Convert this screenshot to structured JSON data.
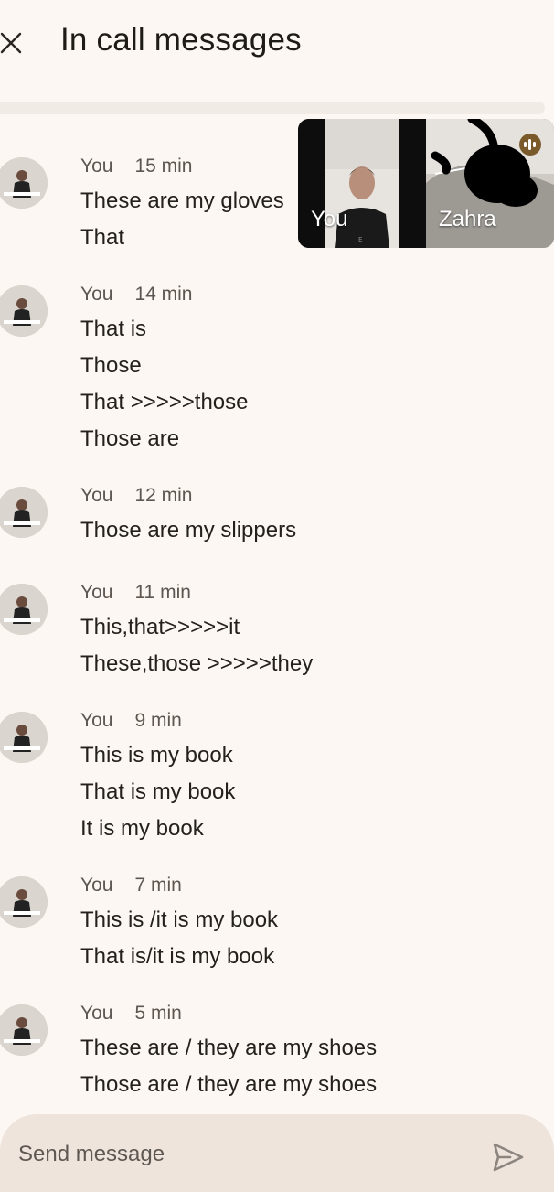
{
  "header": {
    "title": "In call messages",
    "close_icon": "close-icon"
  },
  "video": {
    "you_label": "You",
    "other_label": "Zahra"
  },
  "messages": [
    {
      "sender": "You",
      "time": "15 min",
      "lines": [
        "These are my gloves",
        "That"
      ]
    },
    {
      "sender": "You",
      "time": "14 min",
      "lines": [
        "That is",
        "Those",
        "That >>>>>those",
        "Those are"
      ]
    },
    {
      "sender": "You",
      "time": "12 min",
      "lines": [
        "Those are my slippers"
      ]
    },
    {
      "sender": "You",
      "time": "11 min",
      "lines": [
        "This,that>>>>>it",
        "These,those >>>>>they"
      ]
    },
    {
      "sender": "You",
      "time": "9 min",
      "lines": [
        "This is my book",
        "That is my book",
        "It is my book"
      ]
    },
    {
      "sender": "You",
      "time": "7 min",
      "lines": [
        "This is /it is my book",
        "That is/it is my book"
      ]
    },
    {
      "sender": "You",
      "time": "5 min",
      "lines": [
        "These are / they are my shoes",
        "Those are / they are my shoes"
      ]
    }
  ],
  "composer": {
    "placeholder": "Send message",
    "value": ""
  },
  "colors": {
    "background": "#fcf7f3",
    "composer": "#efe4dc",
    "meta_text": "#5e5650"
  }
}
